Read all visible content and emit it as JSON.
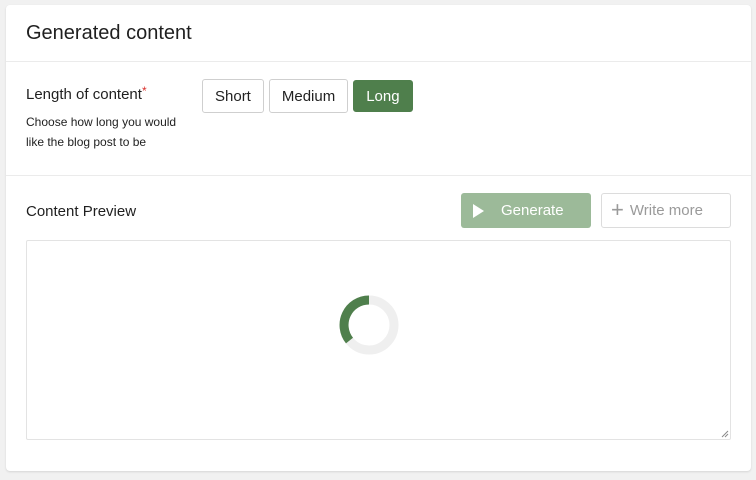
{
  "header": {
    "title": "Generated content"
  },
  "length": {
    "label": "Length of content",
    "required_mark": "*",
    "help": "Choose how long you would like the blog post to be",
    "options": [
      {
        "label": "Short",
        "selected": false
      },
      {
        "label": "Medium",
        "selected": false
      },
      {
        "label": "Long",
        "selected": true
      }
    ]
  },
  "preview": {
    "label": "Content Preview",
    "generate_label": "Generate",
    "write_more_label": "Write more",
    "status": "loading"
  },
  "colors": {
    "accent": "#4f7f4c",
    "accent_disabled": "#9cba99",
    "required": "#d9302c"
  },
  "icons": {
    "generate": "play-icon",
    "write_more": "plus-icon",
    "loading": "spinner-icon"
  }
}
